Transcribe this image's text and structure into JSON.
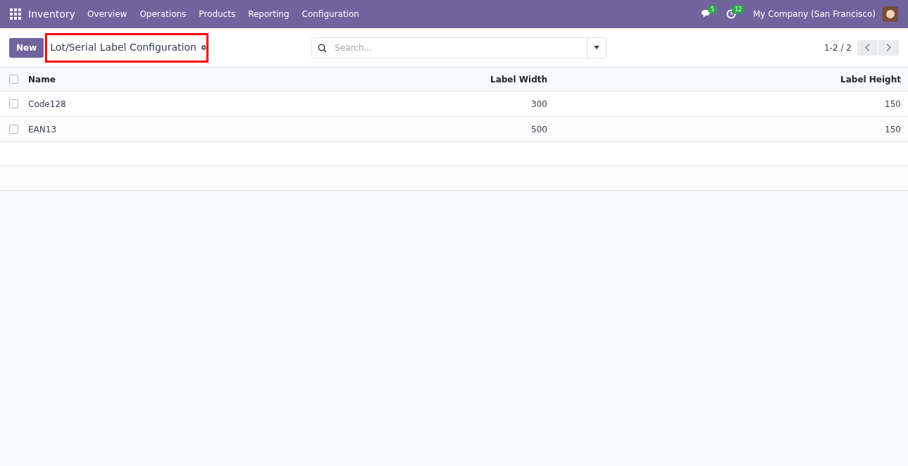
{
  "navbar": {
    "app": "Inventory",
    "menu": [
      "Overview",
      "Operations",
      "Products",
      "Reporting",
      "Configuration"
    ],
    "messages_badge": "5",
    "activities_badge": "12",
    "company": "My Company (San Francisco)"
  },
  "control_panel": {
    "new_button": "New",
    "title": "Lot/Serial Label Configuration",
    "highlighted": true,
    "search": {
      "placeholder": "Search..."
    },
    "pager": "1-2 / 2"
  },
  "table": {
    "select_all_checked": false,
    "columns": [
      "Name",
      "Label Width",
      "Label Height"
    ],
    "rows": [
      {
        "checked": false,
        "cells": [
          "Code128",
          "300",
          "150"
        ]
      },
      {
        "checked": false,
        "cells": [
          "EAN13",
          "500",
          "150"
        ]
      }
    ]
  }
}
